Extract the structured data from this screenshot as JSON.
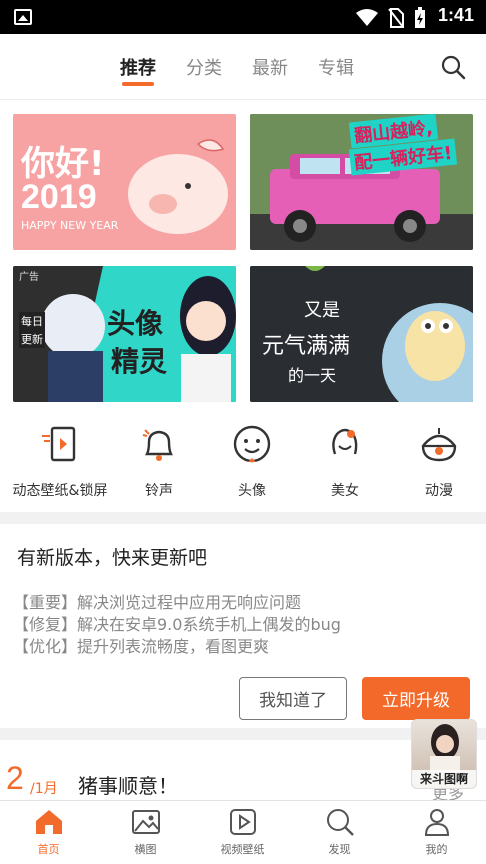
{
  "status_bar": {
    "time": "1:41"
  },
  "top_tabs": [
    {
      "label": "推荐",
      "active": true
    },
    {
      "label": "分类",
      "active": false
    },
    {
      "label": "最新",
      "active": false
    },
    {
      "label": "专辑",
      "active": false
    }
  ],
  "banners": {
    "b1": {
      "big": "你好!",
      "year": "2019",
      "sub": "HAPPY NEW YEAR"
    },
    "b2": {
      "line1": "翻山越岭,",
      "line2": "配一辆好车!"
    },
    "b3": {
      "tag1": "每日",
      "tag2": "更新",
      "corner": "广告",
      "line1": "头像",
      "line2": "精灵"
    },
    "b4": {
      "line1": "又是",
      "line2": "元气满满",
      "line3": "的一天"
    }
  },
  "categories": [
    {
      "label": "动态壁纸&锁屏",
      "icon": "live-wallpaper-icon"
    },
    {
      "label": "铃声",
      "icon": "bell-icon"
    },
    {
      "label": "头像",
      "icon": "face-icon"
    },
    {
      "label": "美女",
      "icon": "girl-icon"
    },
    {
      "label": "动漫",
      "icon": "anime-icon"
    }
  ],
  "update": {
    "title": "有新版本，快来更新吧",
    "lines": [
      "【重要】解决浏览过程中应用无响应问题",
      "【修复】解决在安卓9.0系统手机上偶发的bug",
      "【优化】提升列表流畅度，看图更爽"
    ],
    "dismiss_label": "我知道了",
    "upgrade_label": "立即升级"
  },
  "feed": {
    "day": "2",
    "month": "/1月",
    "title": "猪事顺意！",
    "more": "更多"
  },
  "float_ad": {
    "caption": "来斗图啊"
  },
  "bottom_nav": [
    {
      "label": "首页",
      "icon": "home-icon",
      "active": true
    },
    {
      "label": "横图",
      "icon": "image-icon",
      "active": false
    },
    {
      "label": "视频壁纸",
      "icon": "video-icon",
      "active": false
    },
    {
      "label": "发现",
      "icon": "discover-icon",
      "active": false
    },
    {
      "label": "我的",
      "icon": "profile-icon",
      "active": false
    }
  ],
  "colors": {
    "accent": "#f36b2a",
    "upgrade_button": "#f2692a",
    "divider": "#f1f1f1"
  }
}
